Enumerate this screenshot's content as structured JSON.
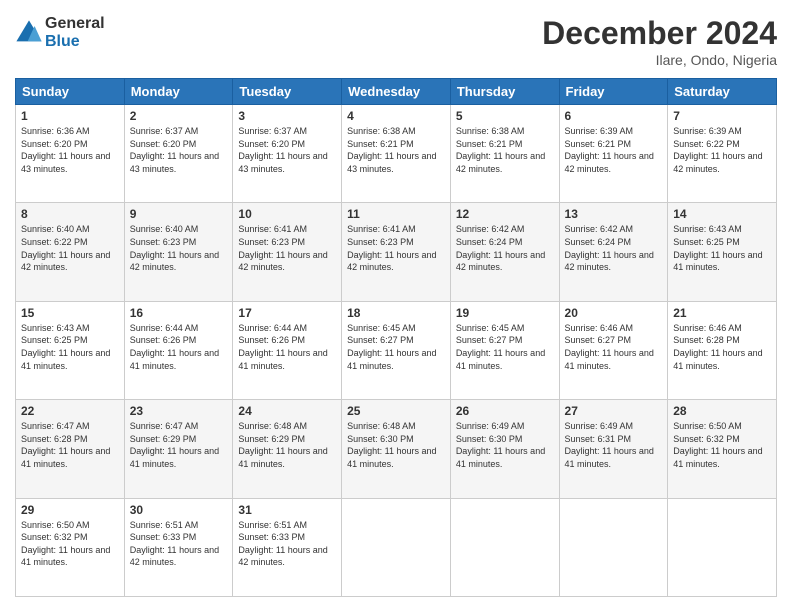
{
  "header": {
    "logo_line1": "General",
    "logo_line2": "Blue",
    "month_title": "December 2024",
    "location": "Ilare, Ondo, Nigeria"
  },
  "days_of_week": [
    "Sunday",
    "Monday",
    "Tuesday",
    "Wednesday",
    "Thursday",
    "Friday",
    "Saturday"
  ],
  "weeks": [
    [
      {
        "day": 1,
        "sunrise": "6:36 AM",
        "sunset": "6:20 PM",
        "daylight": "11 hours and 43 minutes."
      },
      {
        "day": 2,
        "sunrise": "6:37 AM",
        "sunset": "6:20 PM",
        "daylight": "11 hours and 43 minutes."
      },
      {
        "day": 3,
        "sunrise": "6:37 AM",
        "sunset": "6:20 PM",
        "daylight": "11 hours and 43 minutes."
      },
      {
        "day": 4,
        "sunrise": "6:38 AM",
        "sunset": "6:21 PM",
        "daylight": "11 hours and 43 minutes."
      },
      {
        "day": 5,
        "sunrise": "6:38 AM",
        "sunset": "6:21 PM",
        "daylight": "11 hours and 42 minutes."
      },
      {
        "day": 6,
        "sunrise": "6:39 AM",
        "sunset": "6:21 PM",
        "daylight": "11 hours and 42 minutes."
      },
      {
        "day": 7,
        "sunrise": "6:39 AM",
        "sunset": "6:22 PM",
        "daylight": "11 hours and 42 minutes."
      }
    ],
    [
      {
        "day": 8,
        "sunrise": "6:40 AM",
        "sunset": "6:22 PM",
        "daylight": "11 hours and 42 minutes."
      },
      {
        "day": 9,
        "sunrise": "6:40 AM",
        "sunset": "6:23 PM",
        "daylight": "11 hours and 42 minutes."
      },
      {
        "day": 10,
        "sunrise": "6:41 AM",
        "sunset": "6:23 PM",
        "daylight": "11 hours and 42 minutes."
      },
      {
        "day": 11,
        "sunrise": "6:41 AM",
        "sunset": "6:23 PM",
        "daylight": "11 hours and 42 minutes."
      },
      {
        "day": 12,
        "sunrise": "6:42 AM",
        "sunset": "6:24 PM",
        "daylight": "11 hours and 42 minutes."
      },
      {
        "day": 13,
        "sunrise": "6:42 AM",
        "sunset": "6:24 PM",
        "daylight": "11 hours and 42 minutes."
      },
      {
        "day": 14,
        "sunrise": "6:43 AM",
        "sunset": "6:25 PM",
        "daylight": "11 hours and 41 minutes."
      }
    ],
    [
      {
        "day": 15,
        "sunrise": "6:43 AM",
        "sunset": "6:25 PM",
        "daylight": "11 hours and 41 minutes."
      },
      {
        "day": 16,
        "sunrise": "6:44 AM",
        "sunset": "6:26 PM",
        "daylight": "11 hours and 41 minutes."
      },
      {
        "day": 17,
        "sunrise": "6:44 AM",
        "sunset": "6:26 PM",
        "daylight": "11 hours and 41 minutes."
      },
      {
        "day": 18,
        "sunrise": "6:45 AM",
        "sunset": "6:27 PM",
        "daylight": "11 hours and 41 minutes."
      },
      {
        "day": 19,
        "sunrise": "6:45 AM",
        "sunset": "6:27 PM",
        "daylight": "11 hours and 41 minutes."
      },
      {
        "day": 20,
        "sunrise": "6:46 AM",
        "sunset": "6:27 PM",
        "daylight": "11 hours and 41 minutes."
      },
      {
        "day": 21,
        "sunrise": "6:46 AM",
        "sunset": "6:28 PM",
        "daylight": "11 hours and 41 minutes."
      }
    ],
    [
      {
        "day": 22,
        "sunrise": "6:47 AM",
        "sunset": "6:28 PM",
        "daylight": "11 hours and 41 minutes."
      },
      {
        "day": 23,
        "sunrise": "6:47 AM",
        "sunset": "6:29 PM",
        "daylight": "11 hours and 41 minutes."
      },
      {
        "day": 24,
        "sunrise": "6:48 AM",
        "sunset": "6:29 PM",
        "daylight": "11 hours and 41 minutes."
      },
      {
        "day": 25,
        "sunrise": "6:48 AM",
        "sunset": "6:30 PM",
        "daylight": "11 hours and 41 minutes."
      },
      {
        "day": 26,
        "sunrise": "6:49 AM",
        "sunset": "6:30 PM",
        "daylight": "11 hours and 41 minutes."
      },
      {
        "day": 27,
        "sunrise": "6:49 AM",
        "sunset": "6:31 PM",
        "daylight": "11 hours and 41 minutes."
      },
      {
        "day": 28,
        "sunrise": "6:50 AM",
        "sunset": "6:32 PM",
        "daylight": "11 hours and 41 minutes."
      }
    ],
    [
      {
        "day": 29,
        "sunrise": "6:50 AM",
        "sunset": "6:32 PM",
        "daylight": "11 hours and 41 minutes."
      },
      {
        "day": 30,
        "sunrise": "6:51 AM",
        "sunset": "6:33 PM",
        "daylight": "11 hours and 42 minutes."
      },
      {
        "day": 31,
        "sunrise": "6:51 AM",
        "sunset": "6:33 PM",
        "daylight": "11 hours and 42 minutes."
      },
      null,
      null,
      null,
      null
    ]
  ]
}
